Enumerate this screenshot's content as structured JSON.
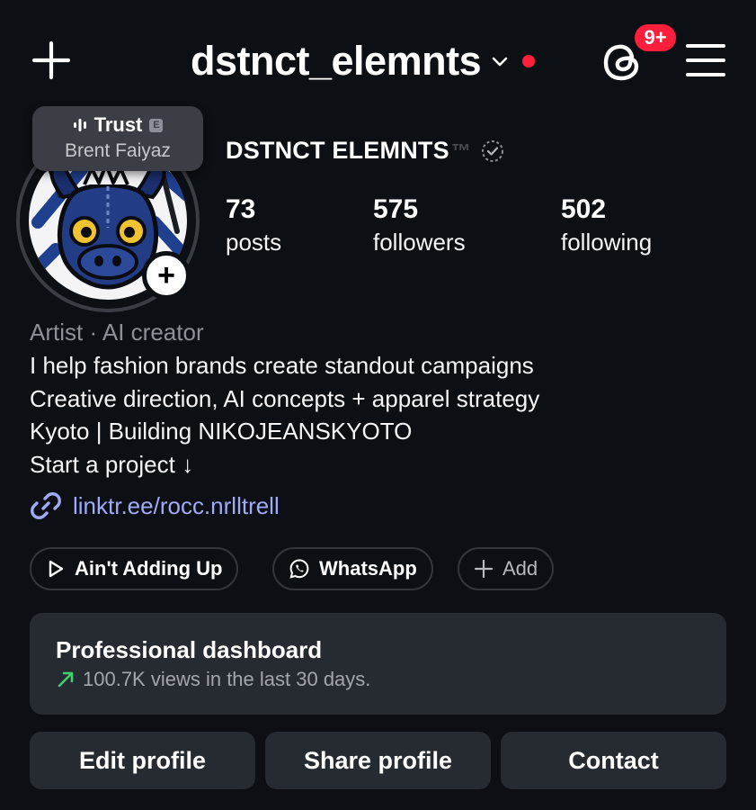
{
  "header": {
    "username": "dstnct_elemnts",
    "notification_badge": "9+",
    "icons": [
      "plus-icon",
      "chevron-down-icon",
      "threads-icon",
      "hamburger-menu-icon"
    ],
    "accent_red": "#ff1f3d"
  },
  "note": {
    "title": "Trust",
    "explicit_tag": "E",
    "artist": "Brent Faiyaz"
  },
  "profile": {
    "display_name": "DSTNCT ELEMNTS",
    "trademark": "™",
    "stats": [
      {
        "value": "73",
        "label": "posts"
      },
      {
        "value": "575",
        "label": "followers"
      },
      {
        "value": "502",
        "label": "following"
      }
    ]
  },
  "bio": {
    "category": "Artist · AI creator",
    "lines": [
      "I help fashion brands create standout campaigns",
      "Creative direction, AI concepts + apparel strategy",
      "Kyoto | Building NIKOJEANSKYOTO",
      "Start a project ↓"
    ],
    "link": "linktr.ee/rocc.nrlltrell",
    "link_color": "#a2aaf8"
  },
  "chips": {
    "music": "Ain't Adding Up",
    "whatsapp": "WhatsApp",
    "add": "Add"
  },
  "dashboard": {
    "title": "Professional dashboard",
    "subtitle": "100.7K views in the last 30 days.",
    "trend_color": "#3ecf6e"
  },
  "actions": {
    "edit": "Edit profile",
    "share": "Share profile",
    "contact": "Contact"
  }
}
